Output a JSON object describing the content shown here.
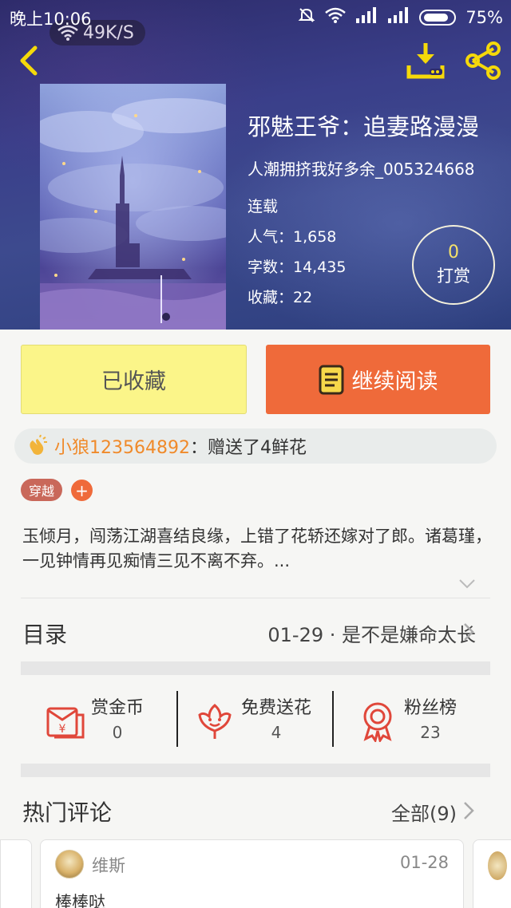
{
  "status_bar": {
    "time": "晚上10:06",
    "net_speed": "49K/S",
    "battery": "75%"
  },
  "book": {
    "title": "邪魅王爷：追妻路漫漫",
    "author": "人潮拥挤我好多余_005324668",
    "status": "连载",
    "popularity": "人气：1,658",
    "word_count": "字数：14,435",
    "favorites": "收藏：22",
    "tip_count": "0",
    "tip_label": "打赏"
  },
  "actions": {
    "collected_label": "已收藏",
    "continue_label": "继续阅读"
  },
  "gift": {
    "user": "小狼123564892",
    "message": "：赠送了4鲜花"
  },
  "tags": [
    "穿越"
  ],
  "tag_add": "+",
  "synopsis": "玉倾月，闯荡江湖喜结良缘，上错了花轿还嫁对了郎。诸葛瑾，一见钟情再见痴情三见不离不弃。...",
  "toc": {
    "label": "目录",
    "latest": "01-29 · 是不是嫌命太长"
  },
  "stats": [
    {
      "name": "赏金币",
      "value": "0",
      "icon": "red-envelope-icon"
    },
    {
      "name": "免费送花",
      "value": "4",
      "icon": "flower-icon"
    },
    {
      "name": "粉丝榜",
      "value": "23",
      "icon": "medal-icon"
    }
  ],
  "comments": {
    "label": "热门评论",
    "all_label": "全部(9)",
    "items": [
      {
        "user": "维斯",
        "date": "01-28",
        "text": "棒棒哒"
      }
    ]
  },
  "colors": {
    "accent_orange": "#ef6a3a",
    "collected_yellow": "#fbf589",
    "gift_user_orange": "#f08a2a",
    "tip_gold": "#f5e26a",
    "icon_red": "#e0473a"
  }
}
